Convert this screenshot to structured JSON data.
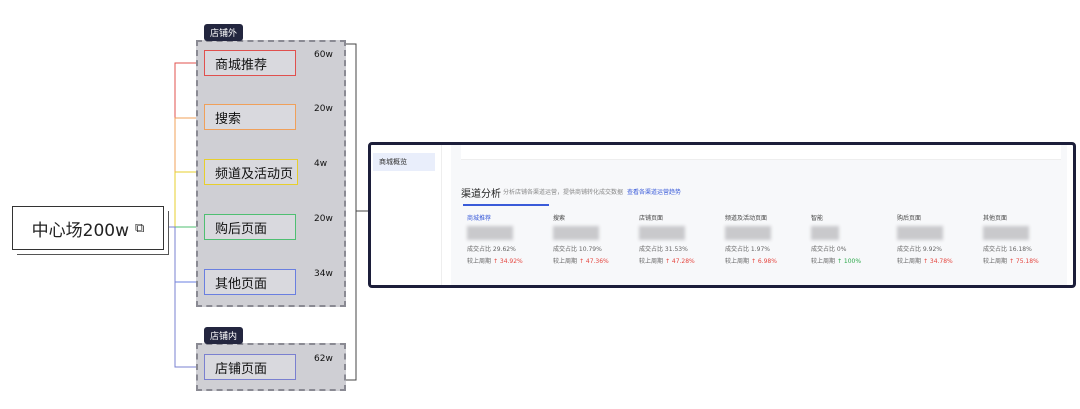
{
  "center": {
    "label": "中心场200w",
    "icon": "link-icon"
  },
  "groups": [
    {
      "tag": "店铺外"
    },
    {
      "tag": "店铺内"
    }
  ],
  "items": [
    {
      "label": "商城推荐",
      "value": "60w",
      "color": "#e0504e"
    },
    {
      "label": "搜索",
      "value": "20w",
      "color": "#f0a05a"
    },
    {
      "label": "频道及活动页",
      "value": "4w",
      "color": "#e7cf2d"
    },
    {
      "label": "购后页面",
      "value": "20w",
      "color": "#4fbf72"
    },
    {
      "label": "其他页面",
      "value": "34w",
      "color": "#6a7fe0"
    },
    {
      "label": "店铺页面",
      "value": "62w",
      "color": "#7a80d0"
    }
  ],
  "screenshot": {
    "sidebar_selected": "商城概览",
    "title": "渠道分析",
    "subtitle": "分析店铺各渠道运营，提供商铺转化成交数据",
    "link": "查看各渠道运营趋势",
    "cards": [
      {
        "name": "商城推荐",
        "ratio": "成交占比 29.62%",
        "compare": "较上周期",
        "delta": "↑ 34.92%",
        "positive": true
      },
      {
        "name": "搜索",
        "ratio": "成交占比 10.79%",
        "compare": "较上周期",
        "delta": "↑ 47.36%",
        "positive": true
      },
      {
        "name": "店铺页面",
        "ratio": "成交占比 31.53%",
        "compare": "较上周期",
        "delta": "↑ 47.28%",
        "positive": true
      },
      {
        "name": "频道及活动页面",
        "ratio": "成交占比 1.97%",
        "compare": "较上周期",
        "delta": "↑ 6.98%",
        "positive": true
      },
      {
        "name": "智能",
        "ratio": "成交占比 0%",
        "compare": "较上周期",
        "delta": "↑ 100%",
        "positive": false
      },
      {
        "name": "购后页面",
        "ratio": "成交占比 9.92%",
        "compare": "较上周期",
        "delta": "↑ 34.78%",
        "positive": true
      },
      {
        "name": "其他页面",
        "ratio": "成交占比 16.18%",
        "compare": "较上周期",
        "delta": "↑ 75.18%",
        "positive": true
      }
    ]
  }
}
